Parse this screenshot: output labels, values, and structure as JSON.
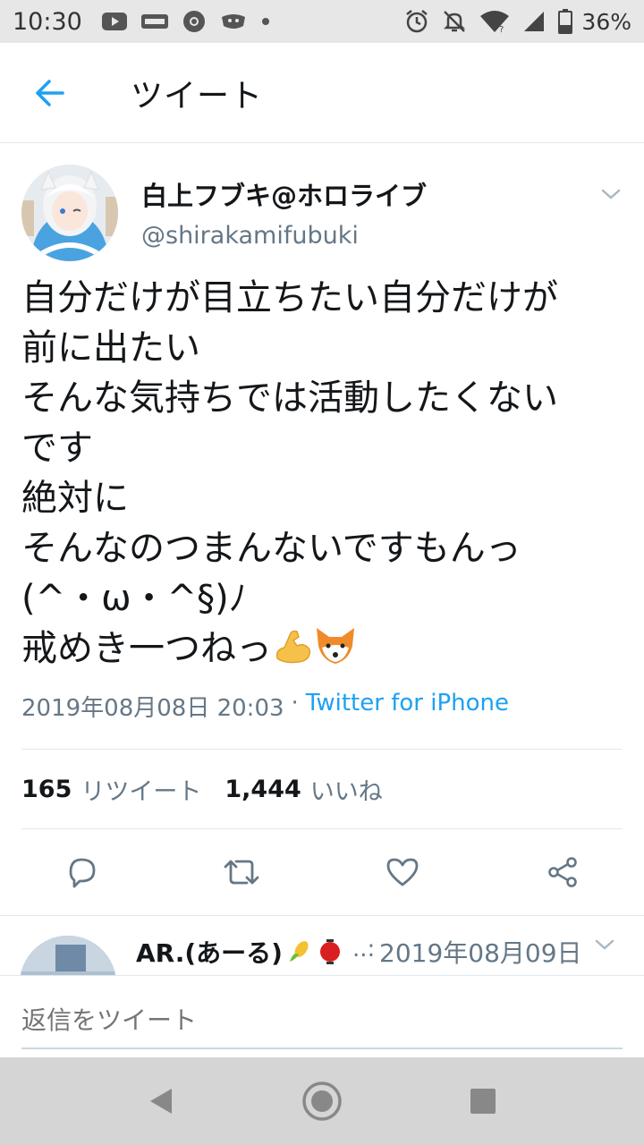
{
  "status_bar": {
    "time": "10:30",
    "battery": "36%",
    "left_icons": [
      "youtube-icon",
      "app-icon",
      "chrome-icon",
      "app2-icon",
      "dot-icon"
    ],
    "right_icons": [
      "alarm-icon",
      "mute-icon",
      "wifi-icon",
      "signal-icon",
      "battery-icon"
    ]
  },
  "appbar": {
    "title": "ツイート",
    "accent": "#1da1f2"
  },
  "tweet": {
    "display_name": "白上フブキ@ホロライブ",
    "handle": "@shirakamifubuki",
    "lines": [
      "自分だけが目立ちたい自分だけが",
      "前に出たい",
      "そんな気持ちでは活動したくない",
      "です",
      "絶対に",
      "そんなのつまんないですもんっ",
      "(^・ω・^§)ﾉ",
      "戒めき一つねっ"
    ],
    "emojis": [
      "flexed-biceps",
      "fox-face"
    ],
    "date": "2019年08月08日 20:03",
    "separator": "·",
    "source": "Twitter for iPhone",
    "retweet_count": "165",
    "retweet_label": "リツイート",
    "like_count": "1,444",
    "like_label": "いいね"
  },
  "reply_preview": {
    "name": "AR.(あーる)",
    "dots": "..:",
    "date": "2019年08月09日"
  },
  "compose": {
    "placeholder": "返信をツイート"
  },
  "colors": {
    "text": "#14171a",
    "secondary": "#657786",
    "link": "#1da1f2",
    "border": "#e1e8ed"
  }
}
